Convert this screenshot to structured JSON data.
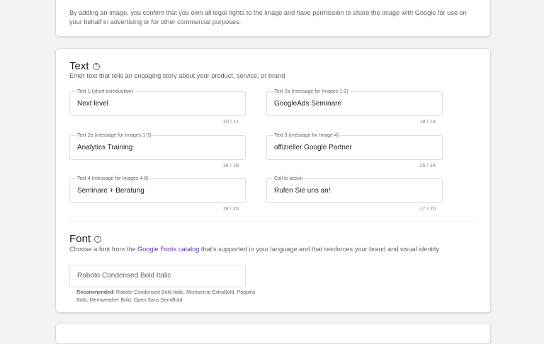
{
  "disclaimer": "By adding an image, you confirm that you own all legal rights to the image and have permission to share the image with Google for use on your behalf in advertising or for other commercial purposes.",
  "text_section": {
    "title": "Text",
    "description": "Enter text that tells an engaging story about your product, service, or brand",
    "fields": [
      {
        "label": "Text 1 (short introduction)",
        "value": "Next level",
        "counter": "10 / 11"
      },
      {
        "label": "Text 2a (message for Images 1-3)",
        "value": "GoogleAds Seminare",
        "counter": "18 / 18"
      },
      {
        "label": "Text 2b (message for Images 1-3)",
        "value": "Analytics Training",
        "counter": "18 / 18"
      },
      {
        "label": "Text 3 (message for Image 4)",
        "value": "offizieller Google Partner",
        "counter": "26 / 34"
      },
      {
        "label": "Text 4 (message for Images 4-6)",
        "value": "Seminare + Beratung",
        "counter": "19 / 20"
      },
      {
        "label": "Call to action",
        "value": "Rufen Sie uns an!",
        "counter": "17 / 20"
      }
    ]
  },
  "font_section": {
    "title": "Font",
    "description_before": "Choose a font from the ",
    "description_link": "Google Fonts catalog",
    "description_after": " that's supported in your language and that reinforces your brand and visual identity",
    "selected_font": "Roboto Condensed Bold Italic",
    "recommended_label": "Recommended:",
    "recommended_fonts": " Roboto Condensed Bold Italic, Montserrat ExtraBold, Poppins Bold, Merriweather Bold, Open Sans SemiBold"
  },
  "icons": {
    "help": "help-circle-icon"
  },
  "colors": {
    "link": "#5e35b1",
    "background": "#f1f3f4",
    "card_border": "#dadce0"
  }
}
